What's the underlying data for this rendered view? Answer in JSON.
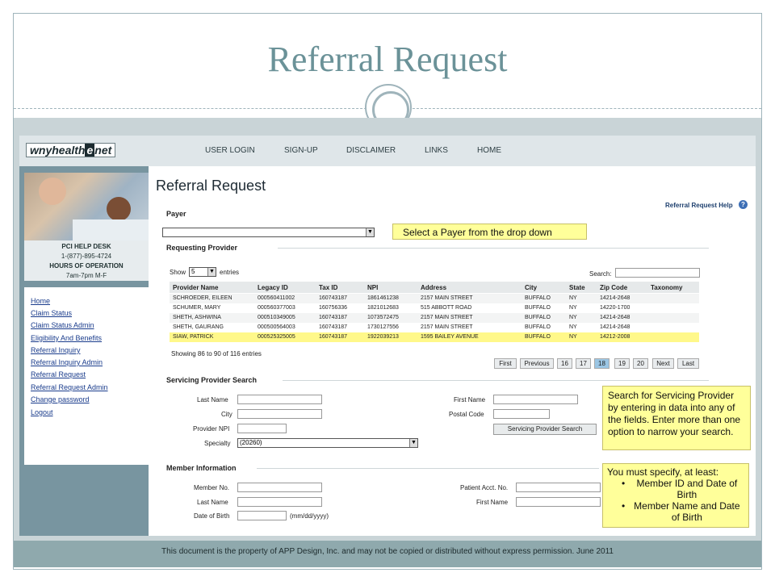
{
  "slide": {
    "title": "Referral Request",
    "footer": "This document is the property of APP Design, Inc. and may not be copied or distributed without express permission.  June 2011"
  },
  "site": {
    "logo_left": "wnyhealth",
    "logo_e": "e",
    "logo_right": "net",
    "nav": [
      "USER LOGIN",
      "SIGN-UP",
      "DISCLAIMER",
      "LINKS",
      "HOME"
    ]
  },
  "sidebar": {
    "help_title": "PCI HELP DESK",
    "help_phone": "1-(877)-895-4724",
    "hours_title": "HOURS OF OPERATION",
    "hours": "7am-7pm M-F",
    "links": [
      "Home",
      "Claim Status",
      "Claim Status Admin",
      "Eligibility And Benefits",
      "Referral Inquiry",
      "Referral Inquiry Admin",
      "Referral Request",
      "Referral Request Admin",
      "Change password",
      "Logout"
    ]
  },
  "page": {
    "title": "Referral Request",
    "help_link": "Referral Request Help",
    "help_icon": "?"
  },
  "payer": {
    "label": "Payer",
    "value": "",
    "callout": "Select a Payer from the drop down"
  },
  "requesting": {
    "label": "Requesting Provider",
    "show": "Show",
    "entries_value": "5",
    "entries": "entries",
    "search_label": "Search:",
    "search_value": "",
    "columns": [
      "Provider Name",
      "Legacy ID",
      "Tax ID",
      "NPI",
      "Address",
      "City",
      "State",
      "Zip Code",
      "Taxonomy"
    ],
    "rows": [
      [
        "SCHROEDER, EILEEN",
        "000560411002",
        "160743187",
        "1861461238",
        "2157 MAIN STREET",
        "BUFFALO",
        "NY",
        "14214-2648",
        ""
      ],
      [
        "SCHUMER, MARY",
        "000560377003",
        "160756336",
        "1821012683",
        "515 ABBOTT ROAD",
        "BUFFALO",
        "NY",
        "14220-1700",
        ""
      ],
      [
        "SHETH, ASHWINA",
        "000510349005",
        "160743187",
        "1073572475",
        "2157 MAIN STREET",
        "BUFFALO",
        "NY",
        "14214-2648",
        ""
      ],
      [
        "SHETH, GAURANG",
        "000500564003",
        "160743187",
        "1730127556",
        "2157 MAIN STREET",
        "BUFFALO",
        "NY",
        "14214-2648",
        ""
      ],
      [
        "SIAW, PATRICK",
        "000525325005",
        "160743187",
        "1922039213",
        "1595 BAILEY AVENUE",
        "BUFFALO",
        "NY",
        "14212-2008",
        ""
      ]
    ],
    "showing": "Showing 86 to 90 of 116 entries",
    "pager": [
      "First",
      "Previous",
      "16",
      "17",
      "18",
      "19",
      "20",
      "Next",
      "Last"
    ],
    "current_page": "18"
  },
  "servicing": {
    "label": "Servicing Provider Search",
    "last_name": "Last Name",
    "city": "City",
    "provider_npi": "Provider NPI",
    "specialty": "Specialty",
    "specialty_value": "(20260)",
    "first_name": "First Name",
    "postal_code": "Postal Code",
    "search_button": "Servicing Provider Search",
    "callout": "Search for Servicing Provider by entering in data into any of the fields. Enter more than one option to narrow your search."
  },
  "member": {
    "label": "Member Information",
    "member_no": "Member No.",
    "last_name": "Last Name",
    "dob": "Date of Birth",
    "dob_hint": "(mm/dd/yyyy)",
    "patient_acct": "Patient Acct. No.",
    "first_name": "First Name",
    "callout_title": "You must specify, at least:",
    "callout_items": [
      "Member ID and Date of Birth",
      "Member Name and Date of Birth"
    ]
  }
}
